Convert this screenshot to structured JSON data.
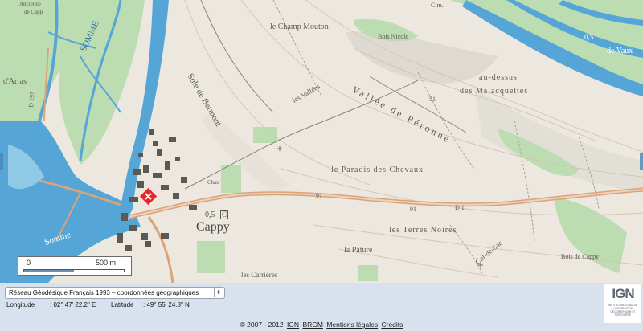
{
  "map": {
    "labels": {
      "champ_mouton": "le Champ Mouton",
      "bois_nicole": "Bois Nicole",
      "sole_bermont": "Sole de Bermont",
      "les_vallees": "les Vallées",
      "vallee_peronne": "Vallée de Péronne",
      "au_dessus": "au-dessus",
      "malacquettes": "des Malacquettes",
      "paradis": "le Paradis des Chevaux",
      "cappy": "Cappy",
      "cappy_elev": "0,5",
      "cappy_marker": "C",
      "terres_noires": "les Terres Noires",
      "cul_de_sac": "Cul-de-Sac",
      "pature": "la Pâture",
      "carrieres": "les Carrières",
      "bois_cappy": "Bois de Cappy",
      "arras": "d'Arras",
      "somme": "SOMME",
      "somme2": "Somme",
      "vaux": "de Vaux",
      "cim": "Cim.",
      "chateau": "Chau",
      "elev_05": "0,5",
      "road_91a": "91",
      "road_91b": "91",
      "road_d1": "D 1",
      "road_51": "51",
      "road_0197": "D 197",
      "ancienne": "Ancienne",
      "capp_top": "de Capp"
    }
  },
  "scale": {
    "zero": "0",
    "distance": "500 m"
  },
  "controls": {
    "crs_value": "Réseau Géodésique Français 1993 – coordonnées géographiques",
    "longitude_label": "Longitude",
    "longitude_value": ": 02° 47' 22.2\" E",
    "latitude_label": "Latitude",
    "latitude_value": ": 49° 55' 24.8\" N"
  },
  "footer": {
    "copyright": "© 2007 - 2012",
    "links": [
      "IGN",
      "BRGM",
      "Mentions légales",
      "Crédits"
    ]
  },
  "logo": {
    "title": "IGN",
    "subtitle": "INSTITUT NATIONAL DE L'INFORMATION GÉOGRAPHIQUE ET FORESTIÈRE"
  },
  "colors": {
    "water": "#55a6d6",
    "forest": "#bcdcb1",
    "road": "#d9a37c",
    "marker": "#e8262a"
  }
}
